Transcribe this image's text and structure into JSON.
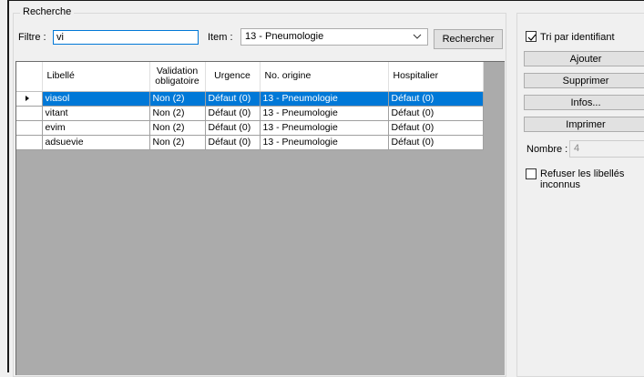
{
  "search": {
    "group_title": "Recherche",
    "filter_label": "Filtre :",
    "filter_value": "vi",
    "item_label": "Item :",
    "item_selected": "13 - Pneumologie",
    "search_button": "Rechercher"
  },
  "grid": {
    "columns": [
      "Libellé",
      "Validation obligatoire",
      "Urgence",
      "No. origine",
      "Hospitalier"
    ],
    "rows": [
      {
        "libelle": "viasol",
        "validation": "Non (2)",
        "urgence": "Défaut (0)",
        "origine": "13 - Pneumologie",
        "hospitalier": "Défaut (0)",
        "selected": true
      },
      {
        "libelle": "vitant",
        "validation": "Non (2)",
        "urgence": "Défaut (0)",
        "origine": "13 - Pneumologie",
        "hospitalier": "Défaut (0)",
        "selected": false
      },
      {
        "libelle": "evim",
        "validation": "Non (2)",
        "urgence": "Défaut (0)",
        "origine": "13 - Pneumologie",
        "hospitalier": "Défaut (0)",
        "selected": false
      },
      {
        "libelle": "adsuevie",
        "validation": "Non (2)",
        "urgence": "Défaut (0)",
        "origine": "13 - Pneumologie",
        "hospitalier": "Défaut (0)",
        "selected": false
      }
    ]
  },
  "side": {
    "sort_checkbox_label": "Tri par identifiant",
    "sort_checked": true,
    "add_button": "Ajouter",
    "delete_button": "Supprimer",
    "info_button": "Infos...",
    "print_button": "Imprimer",
    "count_label": "Nombre :",
    "count_value": "4",
    "refuse_checkbox_label": "Refuser les libellés inconnus",
    "refuse_checked": false
  },
  "colors": {
    "selection": "#0078d7",
    "grid_background": "#ababab",
    "window_background": "#f0f0f0"
  }
}
